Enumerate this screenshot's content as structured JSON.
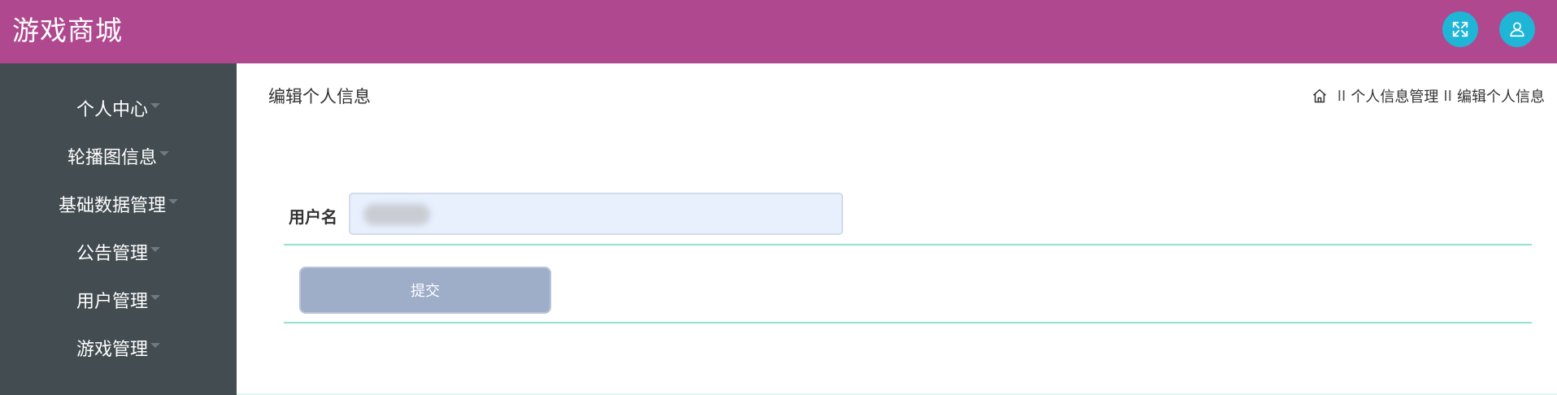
{
  "header": {
    "title": "游戏商城",
    "fullscreen_icon": "expand-arrows-icon",
    "user_icon": "user-icon",
    "background_color": "#b0488f",
    "button_color": "#1fb5d6"
  },
  "sidebar": {
    "background_color": "#434c51",
    "items": [
      {
        "label": "个人中心"
      },
      {
        "label": "轮播图信息"
      },
      {
        "label": "基础数据管理"
      },
      {
        "label": "公告管理"
      },
      {
        "label": "用户管理"
      },
      {
        "label": "游戏管理"
      }
    ]
  },
  "main": {
    "page_title": "编辑个人信息",
    "breadcrumb": {
      "home_icon": "home-icon",
      "separator": "II",
      "items": [
        "个人信息管理",
        "编辑个人信息"
      ]
    },
    "form": {
      "username_label": "用户名",
      "username_value": "",
      "submit_label": "提交"
    },
    "accent_line_color": "#8fe3cf"
  }
}
